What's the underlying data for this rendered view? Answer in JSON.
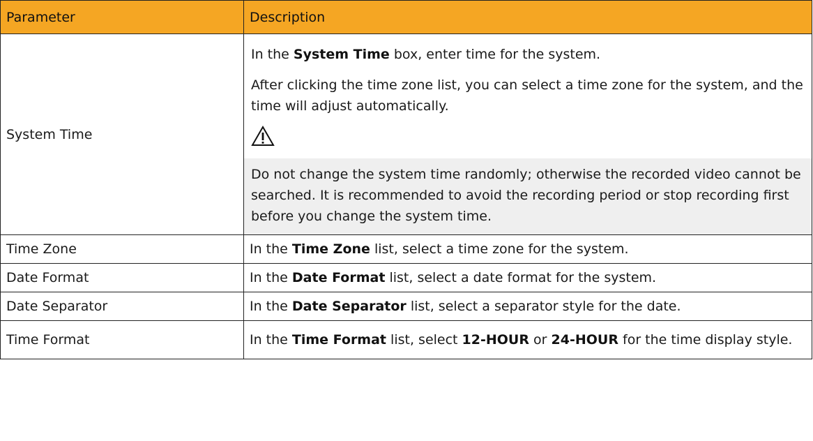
{
  "header": {
    "parameter": "Parameter",
    "description": "Description"
  },
  "rows": [
    {
      "name": "System Time",
      "desc_p1_before": "In the ",
      "desc_p1_bold": "System Time",
      "desc_p1_after": "  box, enter time for the system.",
      "desc_p2": "After clicking the time zone list, you can select a time zone for the system, and the time will adjust automatically.",
      "warning_icon": "warning-triangle-icon",
      "warning_text": "Do not change the system time randomly; otherwise the recorded video cannot be searched. It is recommended to avoid the recording period or stop recording first before you change the system time."
    },
    {
      "name": "Time Zone",
      "before": "In the ",
      "bold": "Time Zone",
      "after": "  list, select a time zone for the system."
    },
    {
      "name": "Date Format",
      "before": "In the ",
      "bold": "Date Format",
      "after": "  list, select a date format for the system."
    },
    {
      "name": "Date Separator",
      "before": "In the ",
      "bold": "Date Separator",
      "after": "  list, select a separator style for the date."
    },
    {
      "name": "Time Format",
      "before": "In the ",
      "bold": "Time Format",
      "mid1": "  list, select ",
      "bold2": "12-HOUR",
      "mid2": " or ",
      "bold3": "24-HOUR",
      "after": " for the time display style."
    }
  ],
  "colors": {
    "header_bg": "#f5a623",
    "warning_bg": "#efefef",
    "border": "#222222"
  }
}
